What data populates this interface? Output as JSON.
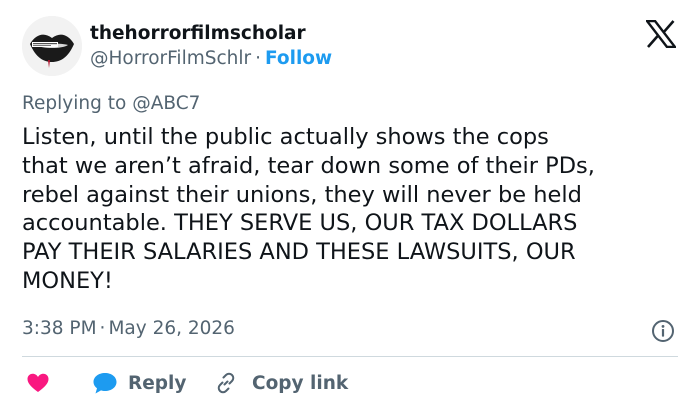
{
  "tweet": {
    "display_name": "thehorrorfilmscholar",
    "handle": "@HorrorFilmSchlr",
    "separator": "·",
    "follow_label": "Follow",
    "replying_prefix": "Replying to",
    "replying_to": "@ABC7",
    "text_lines": [
      "Listen, until the public actually shows the cops",
      "that we aren’t afraid, tear down some of their PDs,",
      "rebel against their unions, they will never be held",
      "accountable. THEY SERVE US, OUR TAX DOLLARS",
      "PAY THEIR SALARIES AND THESE LAWSUITS, OUR",
      "MONEY!"
    ],
    "time": "3:38 PM",
    "date": "May 26, 2026"
  },
  "actions": {
    "reply_label": "Reply",
    "copy_link_label": "Copy link"
  },
  "icons": {
    "platform": "x-logo-icon",
    "info": "info-icon",
    "like": "heart-icon",
    "reply": "speech-bubble-icon",
    "copy": "link-icon"
  },
  "colors": {
    "accent": "#1d9bf0",
    "heart": "#f91880",
    "text": "#0f1419",
    "muted": "#536471",
    "divider": "#cfd9de"
  }
}
